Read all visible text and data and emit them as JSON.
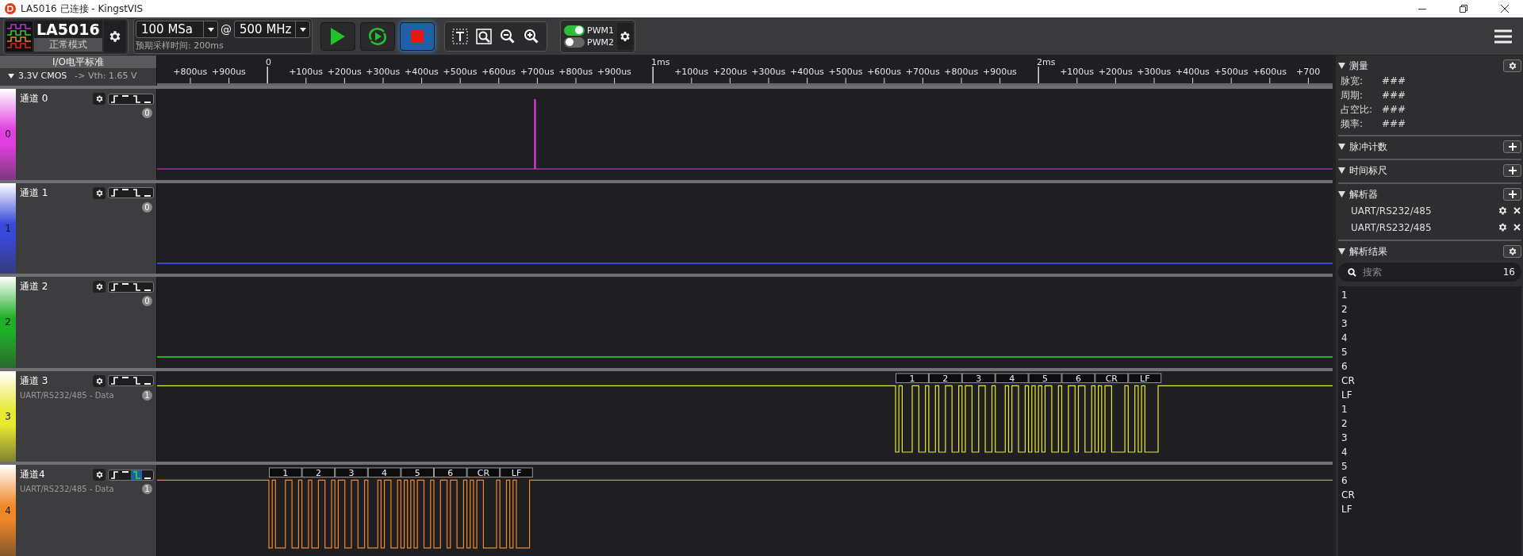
{
  "window": {
    "title": "LA5016 已连接 - KingstVIS"
  },
  "device": {
    "name": "LA5016",
    "mode": "正常模式"
  },
  "sampling": {
    "rate": "100 MSa",
    "at": "@",
    "frequency": "500 MHz",
    "expected_time": "预期采样时间: 200ms"
  },
  "run_controls": [
    {
      "kind": "start",
      "selected": false
    },
    {
      "kind": "loop",
      "selected": false
    },
    {
      "kind": "stop",
      "selected": true
    }
  ],
  "view_tools": [
    {
      "kind": "text"
    },
    {
      "kind": "zoom-box"
    },
    {
      "kind": "zoom-out"
    },
    {
      "kind": "zoom-in"
    }
  ],
  "pwm": [
    {
      "label": "PWM1",
      "on": true
    },
    {
      "label": "PWM2",
      "on": false
    }
  ],
  "io_standard": {
    "title": "I/O电平标准",
    "standard": "3.3V CMOS",
    "threshold": "-> Vth: 1.65 V"
  },
  "ruler": [
    {
      "label": "+800us",
      "kind": "minor"
    },
    {
      "label": "+900us",
      "kind": "minor"
    },
    {
      "label": "0",
      "kind": "major"
    },
    {
      "label": "+100us",
      "kind": "minor"
    },
    {
      "label": "+200us",
      "kind": "minor"
    },
    {
      "label": "+300us",
      "kind": "minor"
    },
    {
      "label": "+400us",
      "kind": "minor"
    },
    {
      "label": "+500us",
      "kind": "minor"
    },
    {
      "label": "+600us",
      "kind": "minor"
    },
    {
      "label": "+700us",
      "kind": "minor"
    },
    {
      "label": "+800us",
      "kind": "minor"
    },
    {
      "label": "+900us",
      "kind": "minor"
    },
    {
      "label": "1ms",
      "kind": "major"
    },
    {
      "label": "+100us",
      "kind": "minor"
    },
    {
      "label": "+200us",
      "kind": "minor"
    },
    {
      "label": "+300us",
      "kind": "minor"
    },
    {
      "label": "+400us",
      "kind": "minor"
    },
    {
      "label": "+500us",
      "kind": "minor"
    },
    {
      "label": "+600us",
      "kind": "minor"
    },
    {
      "label": "+700us",
      "kind": "minor"
    },
    {
      "label": "+800us",
      "kind": "minor"
    },
    {
      "label": "+900us",
      "kind": "minor"
    },
    {
      "label": "2ms",
      "kind": "major"
    },
    {
      "label": "+100us",
      "kind": "minor"
    },
    {
      "label": "+200us",
      "kind": "minor"
    },
    {
      "label": "+300us",
      "kind": "minor"
    },
    {
      "label": "+400us",
      "kind": "minor"
    },
    {
      "label": "+500us",
      "kind": "minor"
    },
    {
      "label": "+600us",
      "kind": "minor"
    },
    {
      "label": "+700",
      "kind": "minor"
    }
  ],
  "channels": [
    {
      "number": "0",
      "name": "通道 0",
      "count": "0",
      "color": "#e040e0",
      "kind": "spike",
      "triggers": [
        {
          "kind": "rising",
          "selected": false
        },
        {
          "kind": "high",
          "selected": false
        },
        {
          "kind": "falling",
          "selected": false
        },
        {
          "kind": "low",
          "selected": false
        }
      ]
    },
    {
      "number": "1",
      "name": "通道 1",
      "count": "0",
      "color": "#3848d8",
      "kind": "low",
      "triggers": [
        {
          "kind": "rising",
          "selected": false
        },
        {
          "kind": "high",
          "selected": false
        },
        {
          "kind": "falling",
          "selected": false
        },
        {
          "kind": "low",
          "selected": false
        }
      ]
    },
    {
      "number": "2",
      "name": "通道 2",
      "count": "0",
      "color": "#20b028",
      "kind": "low",
      "triggers": [
        {
          "kind": "rising",
          "selected": false
        },
        {
          "kind": "high",
          "selected": false
        },
        {
          "kind": "falling",
          "selected": false
        },
        {
          "kind": "low",
          "selected": false
        }
      ]
    },
    {
      "number": "3",
      "name": "通道 3",
      "count": "1",
      "color": "#e8e830",
      "kind": "uart",
      "triggers": [
        {
          "kind": "rising",
          "selected": false
        },
        {
          "kind": "high",
          "selected": false
        },
        {
          "kind": "falling",
          "selected": false
        },
        {
          "kind": "low",
          "selected": false
        }
      ],
      "decoder": "UART/RS232/485 - Data",
      "decoded": [
        "1",
        "2",
        "3",
        "4",
        "5",
        "6",
        "CR",
        "LF"
      ]
    },
    {
      "number": "4",
      "name": "通道4",
      "count": "1",
      "color": "#f08828",
      "kind": "uart",
      "triggers": [
        {
          "kind": "rising",
          "selected": false
        },
        {
          "kind": "high",
          "selected": false
        },
        {
          "kind": "falling",
          "selected": true
        },
        {
          "kind": "low",
          "selected": false
        }
      ],
      "decoder": "UART/RS232/485 - Data",
      "decoded": [
        "1",
        "2",
        "3",
        "4",
        "5",
        "6",
        "CR",
        "LF"
      ]
    }
  ],
  "sidebar": {
    "sections": [
      {
        "title": "测量",
        "kind": "settings",
        "rows": [
          {
            "label": "脉宽:",
            "value": "###"
          },
          {
            "label": "周期:",
            "value": "###"
          },
          {
            "label": "占空比:",
            "value": "###"
          },
          {
            "label": "频率:",
            "value": "###"
          }
        ]
      },
      {
        "title": "脉冲计数",
        "kind": "add"
      },
      {
        "title": "时间标尺",
        "kind": "add"
      },
      {
        "title": "解析器",
        "kind": "add",
        "decoders": [
          "UART/RS232/485",
          "UART/RS232/485"
        ]
      },
      {
        "title": "解析结果",
        "kind": "settings",
        "search": {
          "placeholder": "搜索",
          "count": "16"
        },
        "results": [
          "1",
          "2",
          "3",
          "4",
          "5",
          "6",
          "CR",
          "LF",
          "1",
          "2",
          "3",
          "4",
          "5",
          "6",
          "CR",
          "LF"
        ]
      }
    ]
  }
}
